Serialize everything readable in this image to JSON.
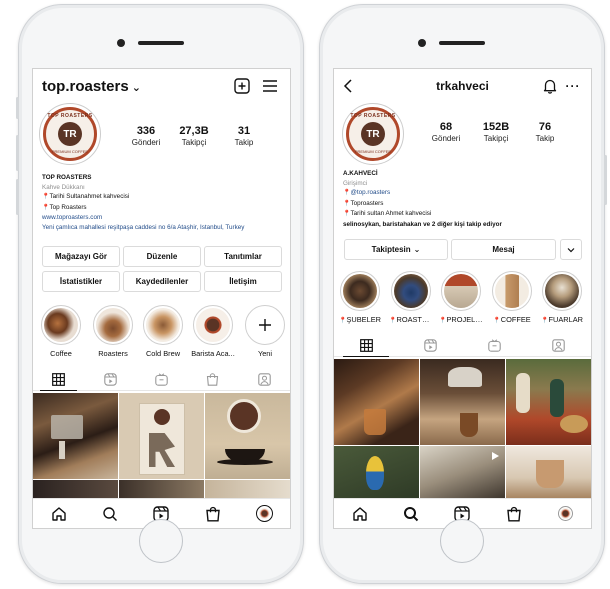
{
  "left_profile": {
    "username": "top.roasters",
    "stats": [
      {
        "value": "336",
        "label": "Gönderi"
      },
      {
        "value": "27,3B",
        "label": "Takipçi"
      },
      {
        "value": "31",
        "label": "Takip"
      }
    ],
    "avatar_text": {
      "top": "TOP ROASTERS",
      "bottom": "PREMIUM COFFEE",
      "core": "TR"
    },
    "bio": {
      "name": "TOP ROASTERS",
      "category": "Kahve Dükkanı",
      "line1": "Tarihi Sultanahmet kahvecisi",
      "line2": "Top Roasters",
      "website": "www.toproasters.com",
      "address": "Yeni çamlıca mahallesi reşitpaşa caddesi no 6/a Ataşhir, Istanbul, Turkey"
    },
    "buttons": [
      "Mağazayı Gör",
      "Düzenle",
      "Tanıtımlar",
      "İstatistikler",
      "Kaydedilenler",
      "İletişim"
    ],
    "highlights": [
      "Coffee",
      "Roasters",
      "Cold Brew",
      "Barista Aca...",
      "Yeni"
    ]
  },
  "right_profile": {
    "username": "trkahveci",
    "stats": [
      {
        "value": "68",
        "label": "Gönderi"
      },
      {
        "value": "152B",
        "label": "Takipçi"
      },
      {
        "value": "76",
        "label": "Takip"
      }
    ],
    "avatar_text": {
      "top": "TOP ROASTERS",
      "bottom": "PREMIUM COFFEE",
      "core": "TR"
    },
    "bio": {
      "name": "A.KAHVECİ",
      "category": "Girişimci",
      "line1": "@top.roasters",
      "line2": "Toproasters",
      "line3": "Tarihi sultan Ahmet kahvecisi",
      "followed_by": "selinosykan, baristahakan",
      "followed_rest": "ve 2 diğer kişi takip ediyor"
    },
    "buttons": {
      "following": "Takiptesin",
      "message": "Mesaj"
    },
    "highlights": [
      "ŞUBELER",
      "ROASTE...",
      "PROJELER",
      "COFFEE",
      "FUARLAR"
    ]
  },
  "colors": {
    "accent_red": "#e2413b",
    "link_blue": "#234d8a",
    "brand_brown": "#5a3425",
    "ring_orange": "#b0482a"
  }
}
